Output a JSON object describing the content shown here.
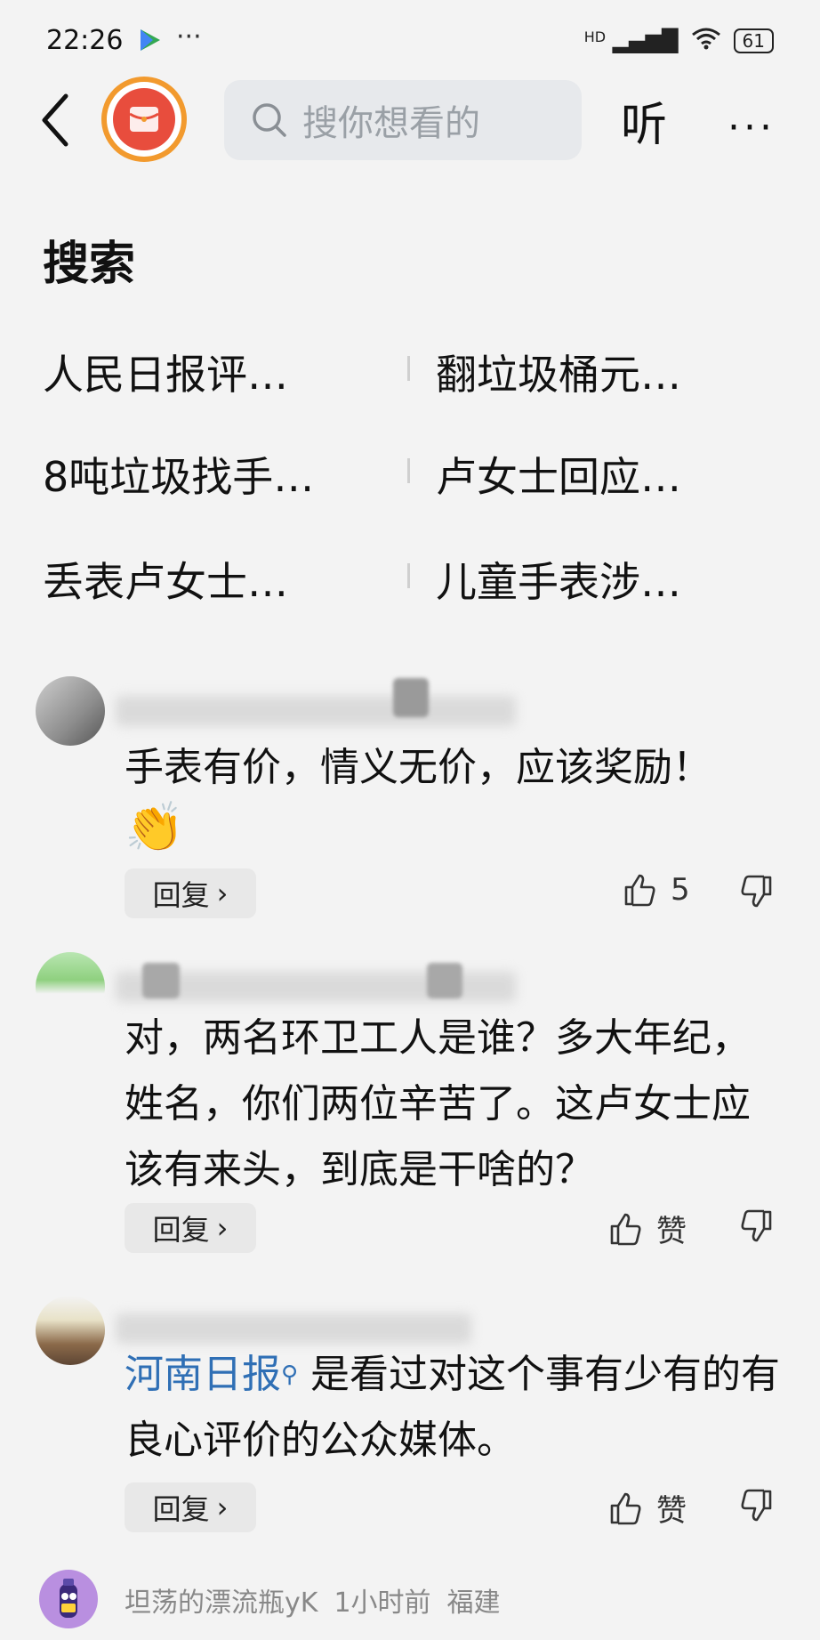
{
  "status_bar": {
    "time": "22:26",
    "dots": "···",
    "network": "HD",
    "battery": "61"
  },
  "top_bar": {
    "search_placeholder": "搜你想看的",
    "listen_label": "听",
    "more_label": "···"
  },
  "search_section": {
    "title": "搜索",
    "items": [
      "人民日报评…",
      "翻垃圾桶元…",
      "8吨垃圾找手…",
      "卢女士回应…",
      "丢表卢女士…",
      "儿童手表涉…"
    ]
  },
  "comments": [
    {
      "text": "手表有价，情义无价，应该奖励！",
      "emoji": "👏",
      "reply_label": "回复",
      "like_value": "5"
    },
    {
      "text": "对，两名环卫工人是谁？多大年纪，姓名，你们两位辛苦了。这卢女士应该有来头，到底是干啥的？",
      "reply_label": "回复",
      "like_value": "赞"
    },
    {
      "link_text": "河南日报",
      "text": "是看过对这个事有少有的有良心评价的公众媒体。",
      "reply_label": "回复",
      "like_value": "赞"
    },
    {
      "username": "坦荡的漂流瓶yK",
      "time": "1小时前",
      "location": "福建"
    }
  ],
  "colors": {
    "link": "#2f6fb5",
    "accent_orange": "#f29a2e",
    "red_icon": "#e84d3d"
  }
}
